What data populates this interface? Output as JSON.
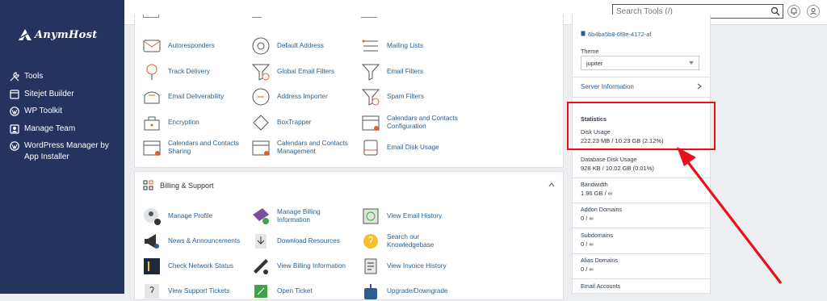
{
  "brand": {
    "logo_text": "AnymHost"
  },
  "sidebar": {
    "items": [
      {
        "label": "Tools",
        "icon": "tools-icon"
      },
      {
        "label": "Sitejet Builder",
        "icon": "sitejet-icon"
      },
      {
        "label": "WP Toolkit",
        "icon": "wordpress-icon"
      },
      {
        "label": "Manage Team",
        "icon": "team-icon"
      },
      {
        "label": "WordPress Manager by App Installer",
        "icon": "wordpress-manager-icon"
      }
    ]
  },
  "topbar": {
    "search_placeholder": "Search Tools (/)"
  },
  "email_section": {
    "rows": [
      [
        "Autoresponders",
        "Default Address",
        "Mailing Lists"
      ],
      [
        "Track Delivery",
        "Global Email Filters",
        "Email Filters"
      ],
      [
        "Email Deliverability",
        "Address Importer",
        "Spam Filters"
      ],
      [
        "Encryption",
        "BoxTrapper",
        "Calendars and Contacts Configuration"
      ],
      [
        "Calendars and Contacts Sharing",
        "Calendars and Contacts Management",
        "Email Disk Usage"
      ]
    ]
  },
  "billing_section": {
    "title": "Billing & Support",
    "rows": [
      [
        "Manage Profile",
        "Manage Billing Information",
        "View Email History"
      ],
      [
        "News & Announcements",
        "Download Resources",
        "Search our Knowledgebase"
      ],
      [
        "Check Network Status",
        "View Billing Information",
        "View Invoice History"
      ],
      [
        "View Support Tickets",
        "Open Ticket",
        "Upgrade/Downgrade"
      ]
    ]
  },
  "right_panel": {
    "account_id": "6b4ba5b8-6f8e-4172-af",
    "theme_label": "Theme",
    "theme_value": "jupiter",
    "server_info": "Server Information",
    "statistics_title": "Statistics",
    "stats": [
      {
        "label": "Disk Usage",
        "value": "222.23 MB / 10.23 GB   (2.12%)"
      },
      {
        "label": "Database Disk Usage",
        "value": "928 KB / 10.02 GB   (0.01%)"
      },
      {
        "label": "Bandwidth",
        "value": "1.96 GB / ∞"
      },
      {
        "label": "Addon Domains",
        "value": "0 / ∞"
      },
      {
        "label": "Subdomains",
        "value": "0 / ∞"
      },
      {
        "label": "Alias Domains",
        "value": "0 / ∞"
      },
      {
        "label": "Email Accounts",
        "value": ""
      }
    ]
  },
  "colors": {
    "sidebar": "#24345f",
    "link": "#2c5f8f",
    "highlight": "#e8101a"
  }
}
